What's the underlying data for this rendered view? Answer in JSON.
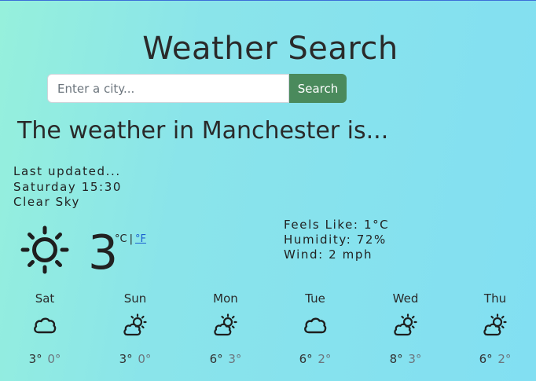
{
  "header": {
    "title": "Weather Search"
  },
  "search": {
    "placeholder": "Enter a city...",
    "button_label": "Search"
  },
  "current": {
    "heading": "The weather in Manchester is...",
    "last_updated_label": "Last updated...",
    "updated_time": "Saturday 15:30",
    "description": "Clear Sky",
    "icon": "sun-icon",
    "temperature": "3",
    "unit_celsius": "°C",
    "unit_separator": "|",
    "unit_fahrenheit": "°F",
    "feels_like": "Feels Like: 1°C",
    "humidity": "Humidity: 72%",
    "wind": "Wind: 2 mph"
  },
  "forecast": [
    {
      "day": "Sat",
      "icon": "cloud-icon",
      "max": "3°",
      "min": "0°"
    },
    {
      "day": "Sun",
      "icon": "sun-cloud-icon",
      "max": "3°",
      "min": "0°"
    },
    {
      "day": "Mon",
      "icon": "sun-cloud-icon",
      "max": "6°",
      "min": "3°"
    },
    {
      "day": "Tue",
      "icon": "cloud-icon",
      "max": "6°",
      "min": "2°"
    },
    {
      "day": "Wed",
      "icon": "sun-cloud-icon",
      "max": "8°",
      "min": "3°"
    },
    {
      "day": "Thu",
      "icon": "sun-cloud-icon",
      "max": "6°",
      "min": "2°"
    }
  ],
  "colors": {
    "background_start": "#96f0dc",
    "background_end": "#82dff2",
    "search_button": "#4a8a5c",
    "link": "#1a5fd0"
  }
}
